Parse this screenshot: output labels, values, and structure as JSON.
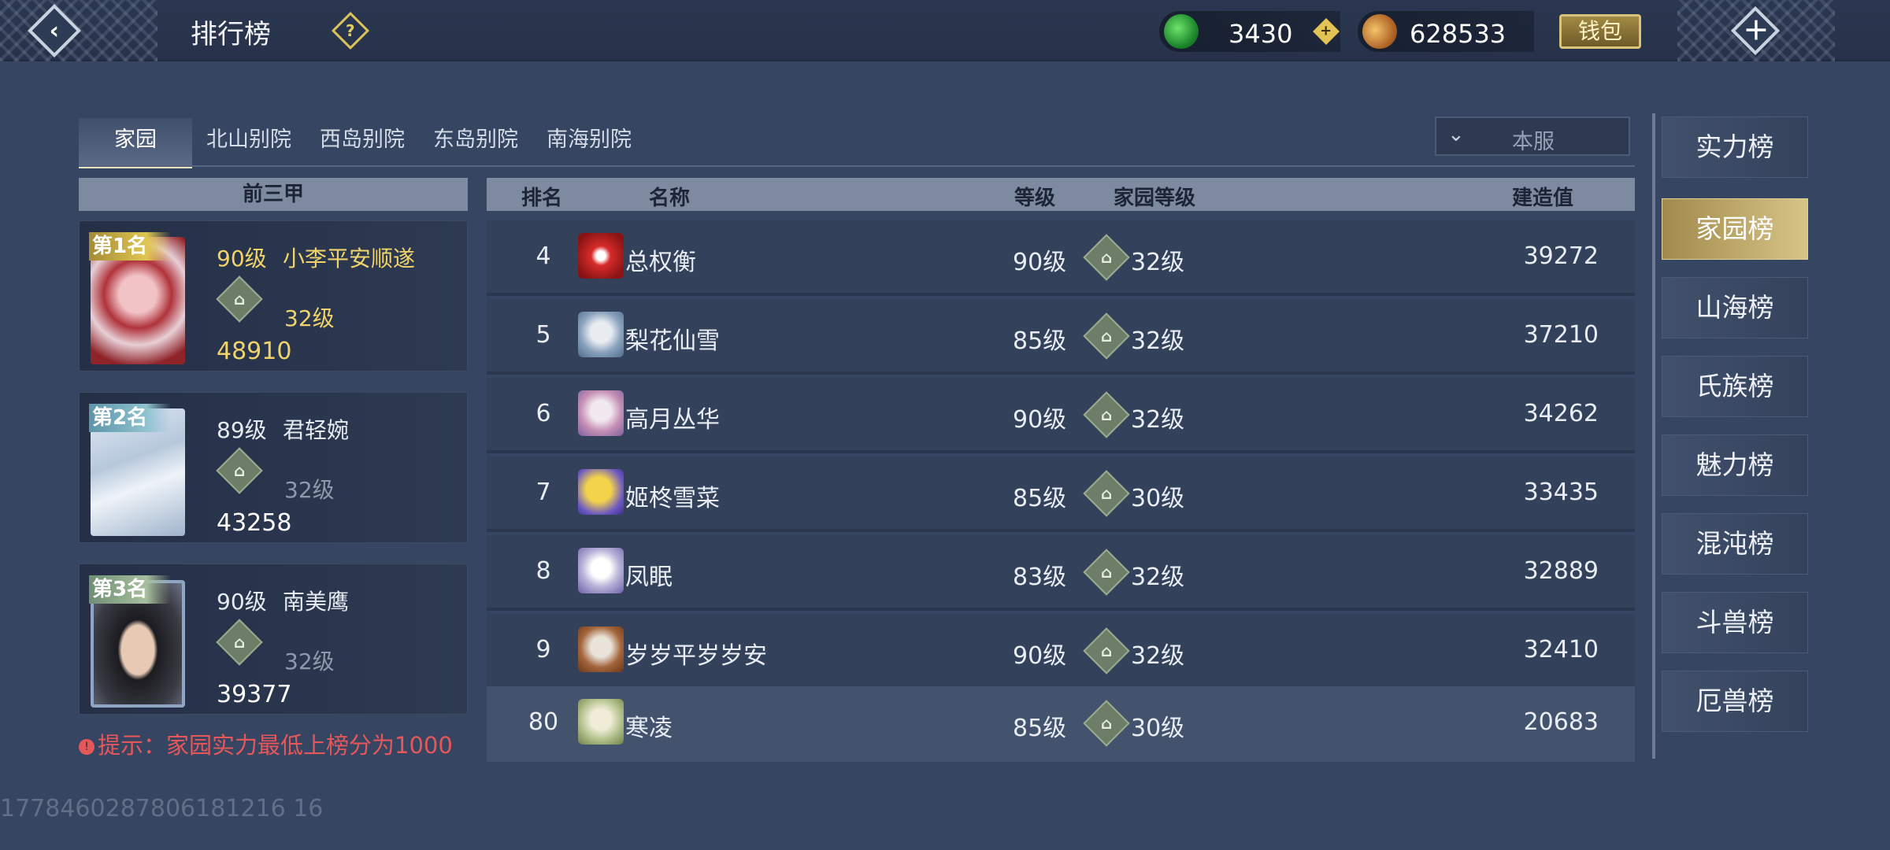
{
  "header": {
    "title": "排行榜",
    "back_icon": "back-arrow-icon",
    "help_icon": "question-icon",
    "jade": "3430",
    "coins": "628533",
    "wallet_label": "钱包",
    "close_icon": "close-icon"
  },
  "tabs": [
    {
      "label": "家园",
      "active": true
    },
    {
      "label": "北山别院",
      "active": false
    },
    {
      "label": "西岛别院",
      "active": false
    },
    {
      "label": "东岛别院",
      "active": false
    },
    {
      "label": "南海别院",
      "active": false
    }
  ],
  "server_dropdown": {
    "value": "本服"
  },
  "top3": {
    "header": "前三甲",
    "entries": [
      {
        "rank": "第1名",
        "level": "90级",
        "name": "小李平安顺遂",
        "home_level": "32级",
        "score": "48910",
        "highlight": true
      },
      {
        "rank": "第2名",
        "level": "89级",
        "name": "君轻婉",
        "home_level": "32级",
        "score": "43258",
        "highlight": false
      },
      {
        "rank": "第3名",
        "level": "90级",
        "name": "南美鹰",
        "home_level": "32级",
        "score": "39377",
        "highlight": false
      }
    ]
  },
  "hint": "提示：家园实力最低上榜分为1000",
  "table": {
    "columns": [
      "排名",
      "名称",
      "等级",
      "家园等级",
      "建造值"
    ],
    "rows": [
      {
        "rank": "4",
        "name": "总权衡",
        "level": "90级",
        "home_level": "32级",
        "score": "39272"
      },
      {
        "rank": "5",
        "name": "梨花仙雪",
        "level": "85级",
        "home_level": "32级",
        "score": "37210"
      },
      {
        "rank": "6",
        "name": "高月丛华",
        "level": "90级",
        "home_level": "32级",
        "score": "34262"
      },
      {
        "rank": "7",
        "name": "姬柊雪菜",
        "level": "85级",
        "home_level": "30级",
        "score": "33435"
      },
      {
        "rank": "8",
        "name": "凤眠",
        "level": "83级",
        "home_level": "32级",
        "score": "32889"
      },
      {
        "rank": "9",
        "name": "岁岁平岁岁安",
        "level": "90级",
        "home_level": "32级",
        "score": "32410"
      }
    ],
    "my_row": {
      "rank": "80",
      "name": "寒凌",
      "level": "85级",
      "home_level": "30级",
      "score": "20683"
    }
  },
  "right_nav": [
    {
      "label": "实力榜",
      "active": false
    },
    {
      "label": "家园榜",
      "active": true
    },
    {
      "label": "山海榜",
      "active": false
    },
    {
      "label": "氏族榜",
      "active": false
    },
    {
      "label": "魅力榜",
      "active": false
    },
    {
      "label": "混沌榜",
      "active": false
    },
    {
      "label": "斗兽榜",
      "active": false
    },
    {
      "label": "厄兽榜",
      "active": false
    }
  ],
  "watermark": "1778460287806181216 16",
  "colors": {
    "gold_text": "#f0d36a",
    "gray_text": "#8f99aa",
    "hint_red": "#e6575a",
    "active_nav": "#d7c487"
  }
}
